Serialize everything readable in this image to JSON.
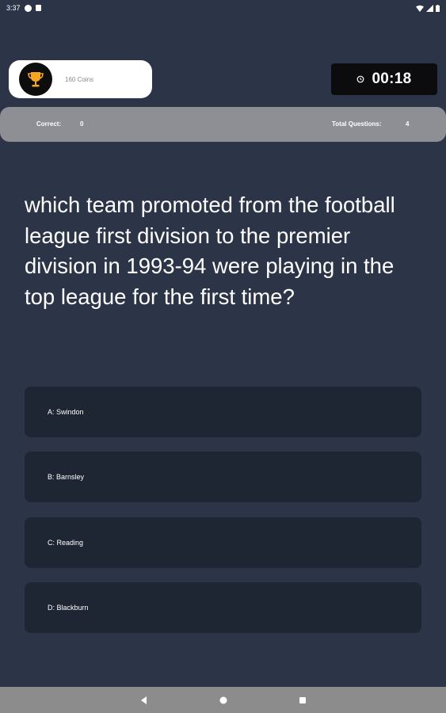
{
  "status_bar": {
    "time": "3:37"
  },
  "coins": {
    "text": "160 Coins",
    "icon": "trophy-icon"
  },
  "timer": {
    "value": "00:18",
    "icon": "timer-icon"
  },
  "score": {
    "correct_label": "Correct:",
    "correct_value": "0",
    "total_label": "Total Questions:",
    "total_value": "4"
  },
  "question": "which team promoted from the football league first division to the premier division in 1993-94 were playing in the top league for the first time?",
  "answers": [
    {
      "label": "A: Swindon"
    },
    {
      "label": "B: Barnsley"
    },
    {
      "label": "C: Reading"
    },
    {
      "label": "D: Blackburn"
    }
  ],
  "colors": {
    "background": "#2c3547",
    "answer_bg": "#1f2633",
    "score_bar": "#8e8e95",
    "timer_bg": "#0c0c0e",
    "trophy_gold": "#f5a623"
  }
}
